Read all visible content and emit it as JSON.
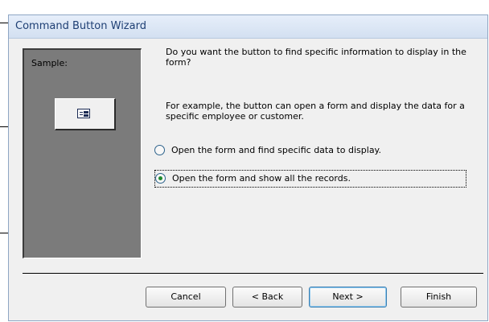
{
  "window": {
    "title": "Command Button Wizard"
  },
  "sample": {
    "label": "Sample:",
    "button_icon": "form-icon"
  },
  "prompt": {
    "question": "Do you want the button to find specific information to display in the form?",
    "example": "For example, the button can open a form and display the data for a specific employee or customer."
  },
  "options": [
    {
      "label": "Open the form and find specific data to display.",
      "selected": false
    },
    {
      "label": "Open the form and show all the records.",
      "selected": true
    }
  ],
  "buttons": {
    "cancel": "Cancel",
    "back": "< Back",
    "next": "Next >",
    "finish": "Finish"
  }
}
